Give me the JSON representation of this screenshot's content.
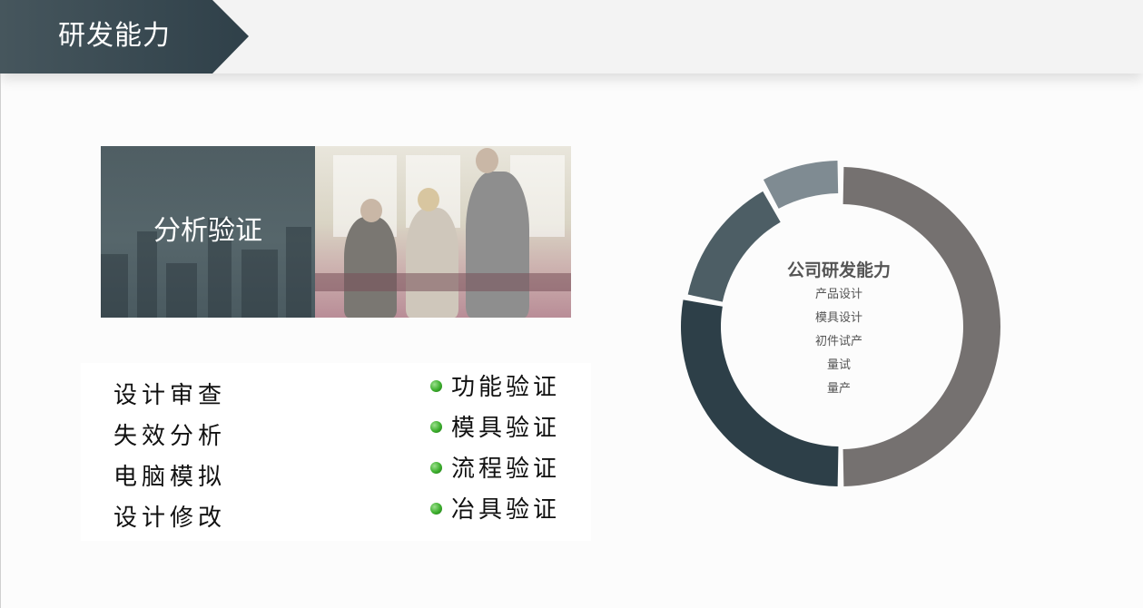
{
  "header": {
    "title": "研发能力"
  },
  "banner": {
    "label": "分析验证"
  },
  "left_list": [
    "设计审查",
    "失效分析",
    "电脑模拟",
    "设计修改"
  ],
  "right_list": [
    "功能验证",
    "模具验证",
    "流程验证",
    "冶具验证"
  ],
  "donut": {
    "center_title": "公司研发能力",
    "center_items": [
      "产品设计",
      "模具设计",
      "初件试产",
      "量试",
      "量产"
    ],
    "segment_colors": [
      "#757170",
      "#2d3f48",
      "#4d5e65",
      "#7f8b92"
    ],
    "segment_fractions": [
      0.5,
      0.28,
      0.14,
      0.08
    ]
  }
}
